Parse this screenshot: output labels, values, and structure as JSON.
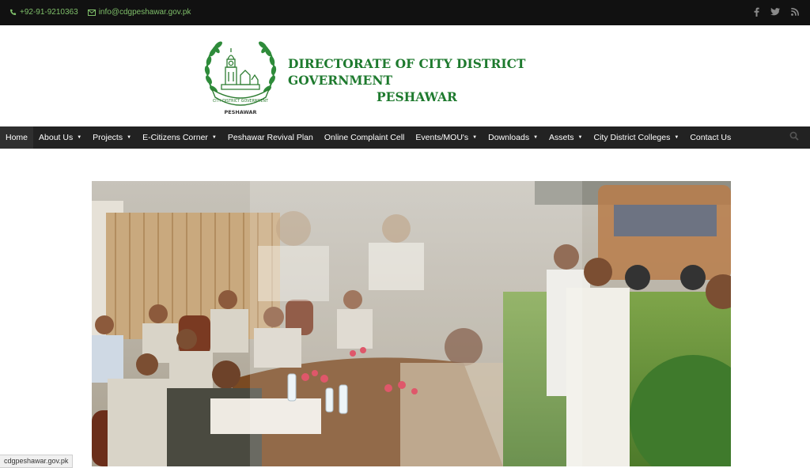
{
  "topbar": {
    "phone": "+92-91-9210363",
    "email": "info@cdgpeshawar.gov.pk",
    "phone_icon": "phone-icon",
    "email_icon": "envelope-icon",
    "social": [
      "facebook-icon",
      "twitter-icon",
      "rss-icon"
    ]
  },
  "header": {
    "title_line1": "DIRECTORATE OF CITY DISTRICT GOVERNMENT",
    "title_line2": "PESHAWAR",
    "logo_caption": "PESHAWAR",
    "logo_ribbon": "CITY DISTRICT GOVERNMENT"
  },
  "nav": {
    "items": [
      {
        "label": "Home"
      },
      {
        "label": "About Us"
      },
      {
        "label": "Projects"
      },
      {
        "label": "E-Citizens Corner"
      },
      {
        "label": "Peshawar Revival Plan"
      },
      {
        "label": "Online Complaint Cell"
      },
      {
        "label": "Events/MOU's"
      },
      {
        "label": "Downloads"
      },
      {
        "label": "Assets"
      },
      {
        "label": "City District Colleges"
      },
      {
        "label": "Contact Us"
      }
    ],
    "caret": "▼"
  },
  "status_bar": {
    "text": "cdgpeshawar.gov.pk"
  },
  "colors": {
    "brand_green": "#1e7a2e",
    "topbar_bg": "#111111",
    "nav_bg": "#222222"
  }
}
